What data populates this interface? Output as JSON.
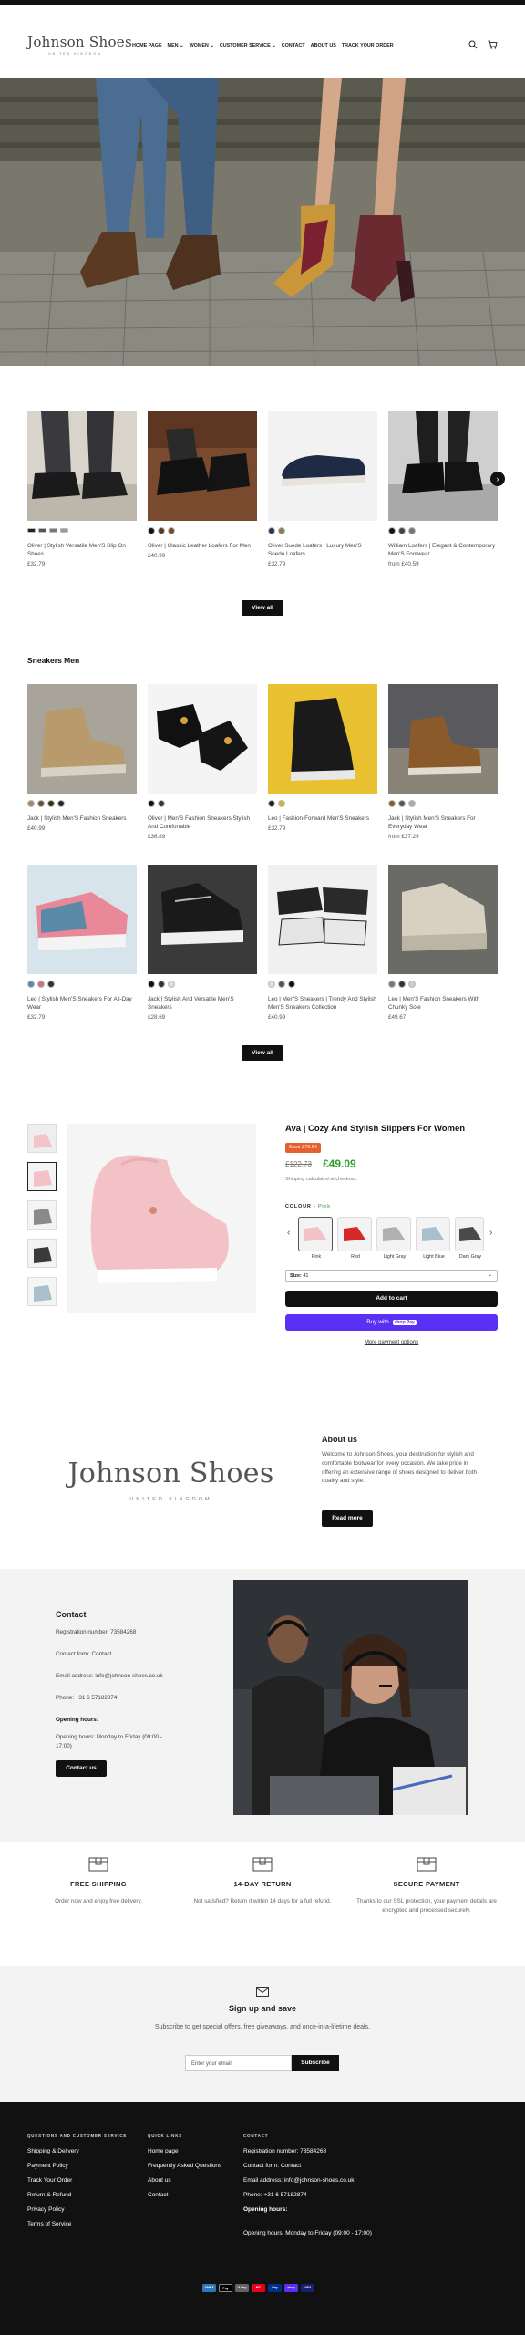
{
  "brand": {
    "name": "Johnson Shoes",
    "tagline": "UNITED KINGDOM"
  },
  "nav": {
    "items": [
      "HOME PAGE",
      "MEN",
      "WOMEN",
      "CUSTOMER SERVICE",
      "CONTACT",
      "ABOUT US",
      "TRACK YOUR ORDER"
    ],
    "dropdown_marker": "⌄",
    "search_icon": "search-icon",
    "cart_icon": "cart-icon"
  },
  "hero": {
    "image": "two people's legs wearing brown men's boots and ochre/burgundy women's heeled boots on cobblestones"
  },
  "collection1": {
    "products": [
      {
        "title": "Oliver | Stylish Versatile Men'S Slip On Shoes",
        "price": "£32.79",
        "swatches": [
          "#222222",
          "#555555",
          "#7a7a7a",
          "#9a9a9a"
        ]
      },
      {
        "title": "Oliver | Classic Leather Loafers For Men",
        "price": "£40.99",
        "swatches": [
          "#111111",
          "#5a3a22",
          "#7a4a2a"
        ]
      },
      {
        "title": "Oliver Suede Loafers | Luxury Men'S Suede Loafers",
        "price": "£32.79",
        "swatches": [
          "#2a3550",
          "#8a7a60"
        ]
      },
      {
        "title": "William Loafers | Elegant & Contemporary Men'S Footwear",
        "price": "from £40.59",
        "swatches": [
          "#111111",
          "#444444",
          "#777777"
        ]
      }
    ],
    "next_arrow": "›",
    "view_all": "View all"
  },
  "sneakers": {
    "heading": "Sneakers Men",
    "products": [
      {
        "title": "Jack | Stylish Men'S Fashion Sneakers",
        "price": "£40.99",
        "swatches": [
          "#a08a6a",
          "#6a5030",
          "#3a2a1a",
          "#222222"
        ]
      },
      {
        "title": "Oliver | Men'S Fashion Sneakers Stylish And Comfortable",
        "price": "£36.89",
        "swatches": [
          "#111111",
          "#333333"
        ]
      },
      {
        "title": "Leo | Fashion-Forward Men'S Sneakers",
        "price": "£32.79",
        "swatches": [
          "#222222",
          "#d9b030"
        ]
      },
      {
        "title": "Jack | Stylish Men'S Sneakers For Everyday Wear",
        "price": "from £37.29",
        "swatches": [
          "#8a5a2a",
          "#555555",
          "#aaaaaa"
        ]
      },
      {
        "title": "Leo | Stylish Men'S Sneakers For All-Day Wear",
        "price": "£32.79",
        "swatches": [
          "#5a8aa8",
          "#d07080",
          "#333333"
        ]
      },
      {
        "title": "Jack | Stylish And Versatile Men'S Sneakers",
        "price": "£28.69",
        "swatches": [
          "#111111",
          "#333333",
          "#dddddd"
        ]
      },
      {
        "title": "Leo | Men'S Sneakers | Trendy And Stylish Men'S Sneakers Collection",
        "price": "£40.99",
        "swatches": [
          "#dddddd",
          "#555555",
          "#111111"
        ]
      },
      {
        "title": "Leo | Men'S Fashion Sneakers With Chunky Sole",
        "price": "£49.67",
        "swatches": [
          "#777777",
          "#333333",
          "#cccccc"
        ]
      }
    ],
    "view_all": "View all"
  },
  "featured": {
    "title": "Ava | Cozy And Stylish Slippers For Women",
    "save_badge": "Save £73.64",
    "old_price": "£122.73",
    "new_price": "£49.09",
    "shipping_note": "Shipping calculated at checkout.",
    "color_label": "COLOUR",
    "color_value": "Pink",
    "color_options": [
      {
        "name": "Pink",
        "color": "#f2c2c6"
      },
      {
        "name": "Red",
        "color": "#d62a2a"
      },
      {
        "name": "Light Gray",
        "color": "#b0b0b0"
      },
      {
        "name": "Light Blue",
        "color": "#a8c0cc"
      },
      {
        "name": "Dark Gray",
        "color": "#4a4a4a"
      }
    ],
    "size_label": "Size:",
    "size_value": "41",
    "add_to_cart": "Add to cart",
    "buy_with": "Buy with",
    "shop_pay": "shop Pay",
    "more_payment": "More payment options",
    "prev_arrow": "‹",
    "next_arrow": "›"
  },
  "about": {
    "heading": "About us",
    "text": "Welcome to Johnson Shoes, your destination for stylish and comfortable footwear for every occasion. We take pride in offering an extensive range of shoes designed to deliver both quality and style.",
    "button": "Read more"
  },
  "contact": {
    "heading": "Contact",
    "registration": "Registration number: 73584268",
    "form": "Contact form: Contact",
    "email": "Email address: info@johnson-shoes.co.uk",
    "phone": "Phone: +31 6 57182874",
    "hours_label": "Opening hours:",
    "hours": "Opening hours: Monday to Friday (09:00 - 17:00)",
    "button": "Contact us"
  },
  "features": [
    {
      "heading": "FREE SHIPPING",
      "text": "Order now and enjoy free delivery."
    },
    {
      "heading": "14-DAY RETURN",
      "text": "Not satisfied? Return it within 14 days for a full refund."
    },
    {
      "heading": "SECURE PAYMENT",
      "text": "Thanks to our SSL protection, your payment details are encrypted and processed securely."
    }
  ],
  "signup": {
    "heading": "Sign up and save",
    "text": "Subscribe to get special offers, free giveaways, and once-in-a-lifetime deals.",
    "placeholder": "Enter your email",
    "button": "Subscribe"
  },
  "footer": {
    "col1": {
      "heading": "QUESTIONS AND CUSTOMER SERVICE",
      "items": [
        "Shipping & Delivery",
        "Payment Policy",
        "Track Your Order",
        "Return & Refund",
        "Privacy Policy",
        "Terms of Service"
      ]
    },
    "col2": {
      "heading": "QUICK LINKS",
      "items": [
        "Home page",
        "Frequently Asked Questions",
        "About us",
        "Contact"
      ]
    },
    "col3": {
      "heading": "CONTACT",
      "items": [
        "Registration number: 73584268",
        "Contact form: Contact",
        "Email address: info@johnson-shoes.co.uk",
        "Phone: +31 6 57182874",
        "Opening hours:",
        "Opening hours: Monday to Friday (09:00 - 17:00)"
      ]
    },
    "payments": [
      {
        "name": "AMEX",
        "color": "#2e77bc"
      },
      {
        "name": "Pay",
        "color": "#000000"
      },
      {
        "name": "G Pay",
        "color": "#5f6368"
      },
      {
        "name": "MC",
        "color": "#eb001b"
      },
      {
        "name": "Pay",
        "color": "#003087"
      },
      {
        "name": "shop",
        "color": "#5a31f4"
      },
      {
        "name": "VISA",
        "color": "#1a1f71"
      }
    ]
  },
  "colors": {
    "accent_green": "#2fa02f",
    "save_orange": "#e4602d",
    "shop_pay_purple": "#5a31f4",
    "dark": "#111111"
  }
}
